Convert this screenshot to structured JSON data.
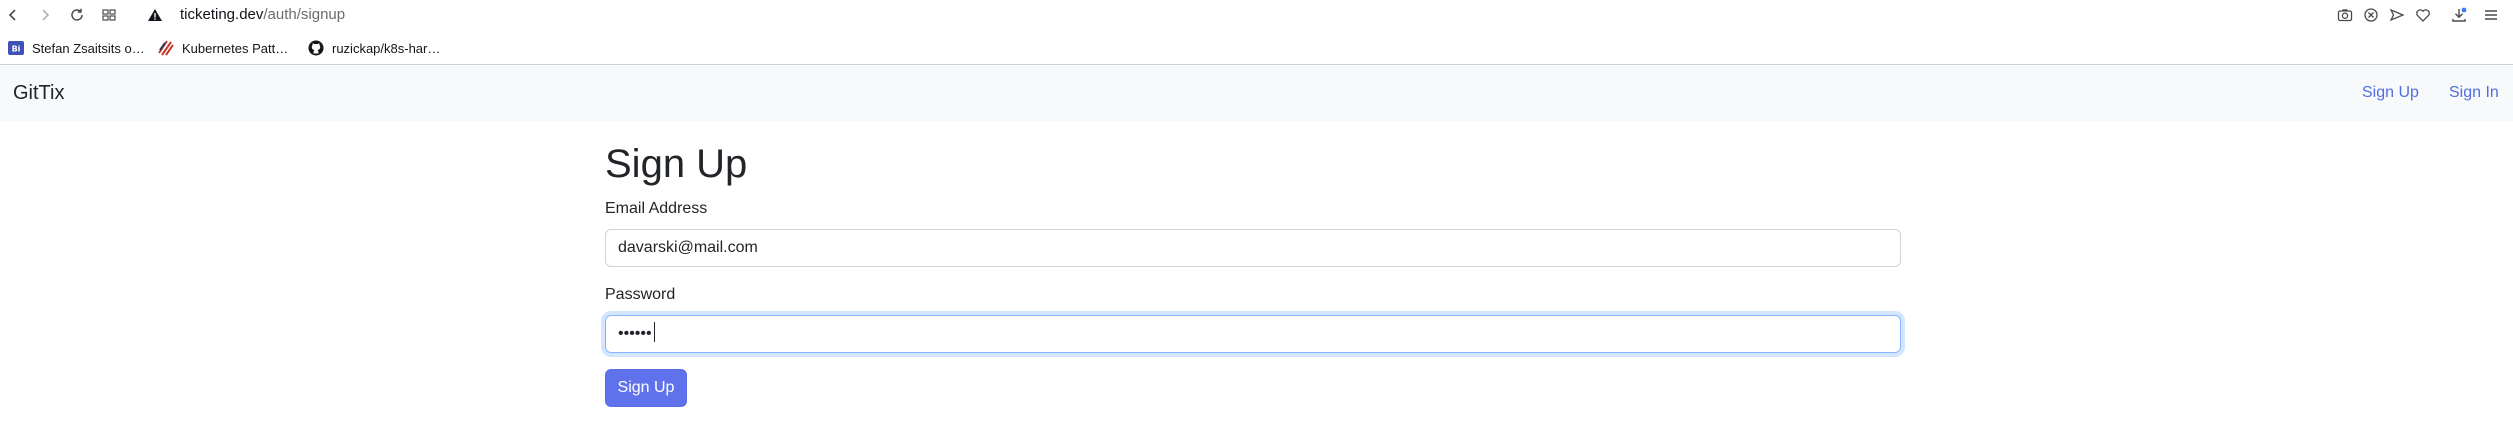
{
  "browser": {
    "url": {
      "host": "ticketing.dev",
      "path": "/auth/signup"
    },
    "bookmarks": [
      {
        "label": "Stefan Zsaitsits o…",
        "favicon": "bi-favicon"
      },
      {
        "label": "Kubernetes Patt…",
        "favicon": "stripes-favicon"
      },
      {
        "label": "ruzickap/k8s-har…",
        "favicon": "github-favicon"
      }
    ]
  },
  "navbar": {
    "brand": "GitTix",
    "links": [
      "Sign Up",
      "Sign In"
    ]
  },
  "form": {
    "title": "Sign Up",
    "email": {
      "label": "Email Address",
      "value": "davarski@mail.com"
    },
    "password": {
      "label": "Password",
      "value": "••••••"
    },
    "submit_label": "Sign Up"
  },
  "colors": {
    "link": "#4f6fe0",
    "button": "#5f72ec",
    "navbar_bg": "#f8f9fa",
    "focus_ring": "#86b7fe"
  }
}
